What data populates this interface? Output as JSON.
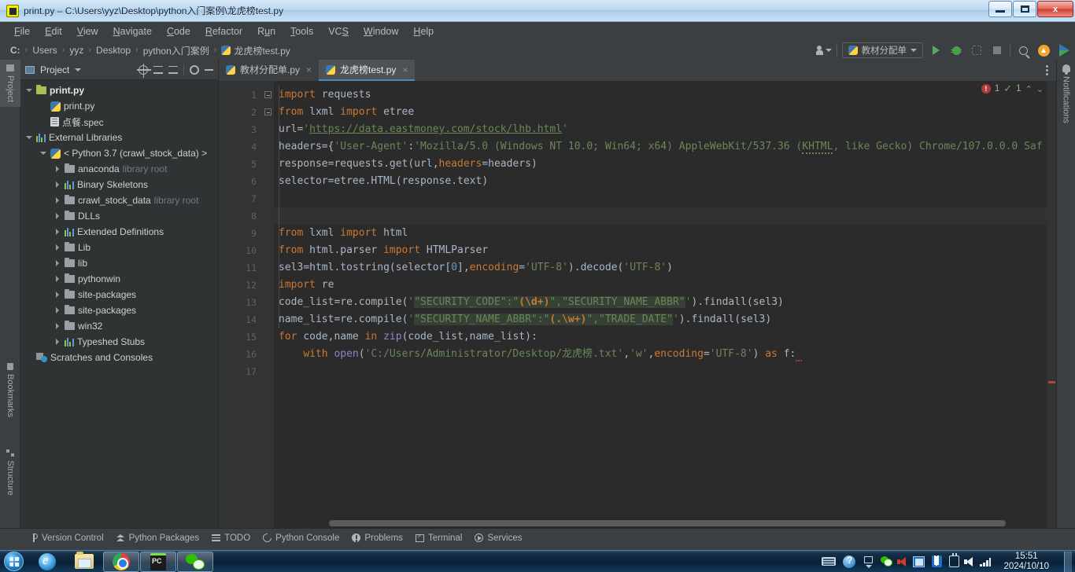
{
  "window": {
    "title": "print.py – C:\\Users\\yyz\\Desktop\\python入门案例\\龙虎榜test.py",
    "app_icon": "pycharm-window-icon",
    "minimize": "–",
    "maximize": "□",
    "close": "x"
  },
  "menubar": {
    "items": [
      {
        "label": "File",
        "mnemonic": "F"
      },
      {
        "label": "Edit",
        "mnemonic": "E"
      },
      {
        "label": "View",
        "mnemonic": "V"
      },
      {
        "label": "Navigate",
        "mnemonic": "N"
      },
      {
        "label": "Code",
        "mnemonic": "C"
      },
      {
        "label": "Refactor",
        "mnemonic": "R"
      },
      {
        "label": "Run",
        "mnemonic": "u"
      },
      {
        "label": "Tools",
        "mnemonic": "T"
      },
      {
        "label": "VCS",
        "mnemonic": ""
      },
      {
        "label": "Window",
        "mnemonic": "W"
      },
      {
        "label": "Help",
        "mnemonic": "H"
      }
    ]
  },
  "breadcrumb": {
    "separator": "›",
    "items": [
      "C:",
      "Users",
      "yyz",
      "Desktop",
      "python入门案例",
      "龙虎榜test.py"
    ]
  },
  "toolbar": {
    "run_config": "教材分配单",
    "run_label": "Run",
    "debug_label": "Debug",
    "coverage_label": "Run with Coverage",
    "stop_label": "Stop",
    "search_label": "Search Everywhere",
    "update_label": "Update Project",
    "profile_label": "Profile"
  },
  "left_strip": {
    "project": "Project",
    "bookmarks": "Bookmarks",
    "structure": "Structure"
  },
  "project_panel": {
    "title": "Project",
    "tree": [
      {
        "indent": 0,
        "arrow": "down",
        "icon": "folder-src",
        "label": "print.py",
        "suffix": "",
        "bold": true
      },
      {
        "indent": 1,
        "arrow": "none",
        "icon": "python-file",
        "label": "print.py",
        "suffix": "",
        "bold": false
      },
      {
        "indent": 1,
        "arrow": "none",
        "icon": "spec-file",
        "label": "点餐.spec",
        "suffix": "",
        "bold": false
      },
      {
        "indent": 0,
        "arrow": "down",
        "icon": "library-bars",
        "label": "External Libraries",
        "suffix": "",
        "bold": false
      },
      {
        "indent": 1,
        "arrow": "down",
        "icon": "python-logo",
        "label": "< Python 3.7 (crawl_stock_data) >",
        "suffix": "",
        "bold": false
      },
      {
        "indent": 2,
        "arrow": "right",
        "icon": "folder",
        "label": "anaconda",
        "suffix": "library root",
        "bold": false
      },
      {
        "indent": 2,
        "arrow": "right",
        "icon": "library-bars",
        "label": "Binary Skeletons",
        "suffix": "",
        "bold": false
      },
      {
        "indent": 2,
        "arrow": "right",
        "icon": "folder",
        "label": "crawl_stock_data",
        "suffix": "library root",
        "bold": false
      },
      {
        "indent": 2,
        "arrow": "right",
        "icon": "folder",
        "label": "DLLs",
        "suffix": "",
        "bold": false
      },
      {
        "indent": 2,
        "arrow": "right",
        "icon": "library-bars",
        "label": "Extended Definitions",
        "suffix": "",
        "bold": false
      },
      {
        "indent": 2,
        "arrow": "right",
        "icon": "folder",
        "label": "Lib",
        "suffix": "",
        "bold": false
      },
      {
        "indent": 2,
        "arrow": "right",
        "icon": "folder",
        "label": "lib",
        "suffix": "",
        "bold": false
      },
      {
        "indent": 2,
        "arrow": "right",
        "icon": "folder",
        "label": "pythonwin",
        "suffix": "",
        "bold": false
      },
      {
        "indent": 2,
        "arrow": "right",
        "icon": "folder",
        "label": "site-packages",
        "suffix": "",
        "bold": false
      },
      {
        "indent": 2,
        "arrow": "right",
        "icon": "folder",
        "label": "site-packages",
        "suffix": "",
        "bold": false
      },
      {
        "indent": 2,
        "arrow": "right",
        "icon": "folder",
        "label": "win32",
        "suffix": "",
        "bold": false
      },
      {
        "indent": 2,
        "arrow": "right",
        "icon": "library-bars",
        "label": "Typeshed Stubs",
        "suffix": "",
        "bold": false
      },
      {
        "indent": 0,
        "arrow": "none",
        "icon": "scratches",
        "label": "Scratches and Consoles",
        "suffix": "",
        "bold": false
      }
    ]
  },
  "editor": {
    "tabs": [
      {
        "label": "教材分配单.py",
        "active": false,
        "close": "×"
      },
      {
        "label": "龙虎榜test.py",
        "active": true,
        "close": "×"
      }
    ],
    "inspections": {
      "error_count": "1",
      "error_glyph": "!",
      "ok_count": "1",
      "ok_glyph": "✓",
      "up": "⌃",
      "down": "⌄"
    },
    "line_numbers": [
      "1",
      "2",
      "3",
      "4",
      "5",
      "6",
      "7",
      "8",
      "9",
      "10",
      "11",
      "12",
      "13",
      "14",
      "15",
      "16",
      "17"
    ],
    "current_line": 8,
    "lines": [
      "import requests",
      "from lxml import etree",
      "url='https://data.eastmoney.com/stock/lhb.html'",
      "headers={'User-Agent':'Mozilla/5.0 (Windows NT 10.0; Win64; x64) AppleWebKit/537.36 (KHTML, like Gecko) Chrome/107.0.0.0 Saf",
      "response=requests.get(url,headers=headers)",
      "selector=etree.HTML(response.text)",
      "",
      "",
      "from lxml import html",
      "from html.parser import HTMLParser",
      "sel3=html.tostring(selector[0],encoding='UTF-8').decode('UTF-8')",
      "import re",
      "code_list=re.compile('\"SECURITY_CODE\":\"(\\d+)\",\"SECURITY_NAME_ABBR\"').findall(sel3)",
      "name_list=re.compile('\"SECURITY_NAME_ABBR\":\"(.\\w+)\",\"TRADE_DATE\"').findall(sel3)",
      "for code,name in zip(code_list,name_list):",
      "    with open('C:/Users/Administrator/Desktop/龙虎榜.txt','w',encoding='UTF-8') as f:",
      ""
    ]
  },
  "notifications": {
    "label": "Notifications",
    "icon": "bell-icon"
  },
  "statusbar": {
    "items": [
      {
        "label": "Version Control",
        "icon": "branch-icon"
      },
      {
        "label": "Python Packages",
        "icon": "packages-icon"
      },
      {
        "label": "TODO",
        "icon": "todo-icon"
      },
      {
        "label": "Python Console",
        "icon": "console-icon"
      },
      {
        "label": "Problems",
        "icon": "problems-icon"
      },
      {
        "label": "Terminal",
        "icon": "terminal-icon"
      },
      {
        "label": "Services",
        "icon": "services-icon"
      }
    ]
  },
  "taskbar": {
    "start": "start-orb",
    "apps": [
      {
        "name": "internet-explorer",
        "pinned": true
      },
      {
        "name": "file-explorer",
        "pinned": true
      },
      {
        "name": "google-chrome",
        "running": true
      },
      {
        "name": "pycharm",
        "running": true
      },
      {
        "name": "wechat",
        "running": true
      }
    ],
    "tray": [
      "keyboard-icon",
      "help-icon",
      "show-hidden-icon",
      "wechat-icon",
      "volume-mute-icon",
      "network-icon",
      "bluetooth-icon",
      "safely-remove-icon",
      "volume-icon",
      "signal-icon"
    ],
    "clock_time": "15:51",
    "clock_date": "2024/10/10"
  },
  "colors": {
    "accent": "#4a88c7",
    "editor_bg": "#2b2b2b",
    "panel_bg": "#3c3f41",
    "tree_bg": "#2f3334",
    "keyword": "#cc7832",
    "string": "#6a8759",
    "number": "#6897bb",
    "identifier": "#a9b7c6",
    "error": "#b33b3b",
    "ok": "#5bb85b"
  }
}
